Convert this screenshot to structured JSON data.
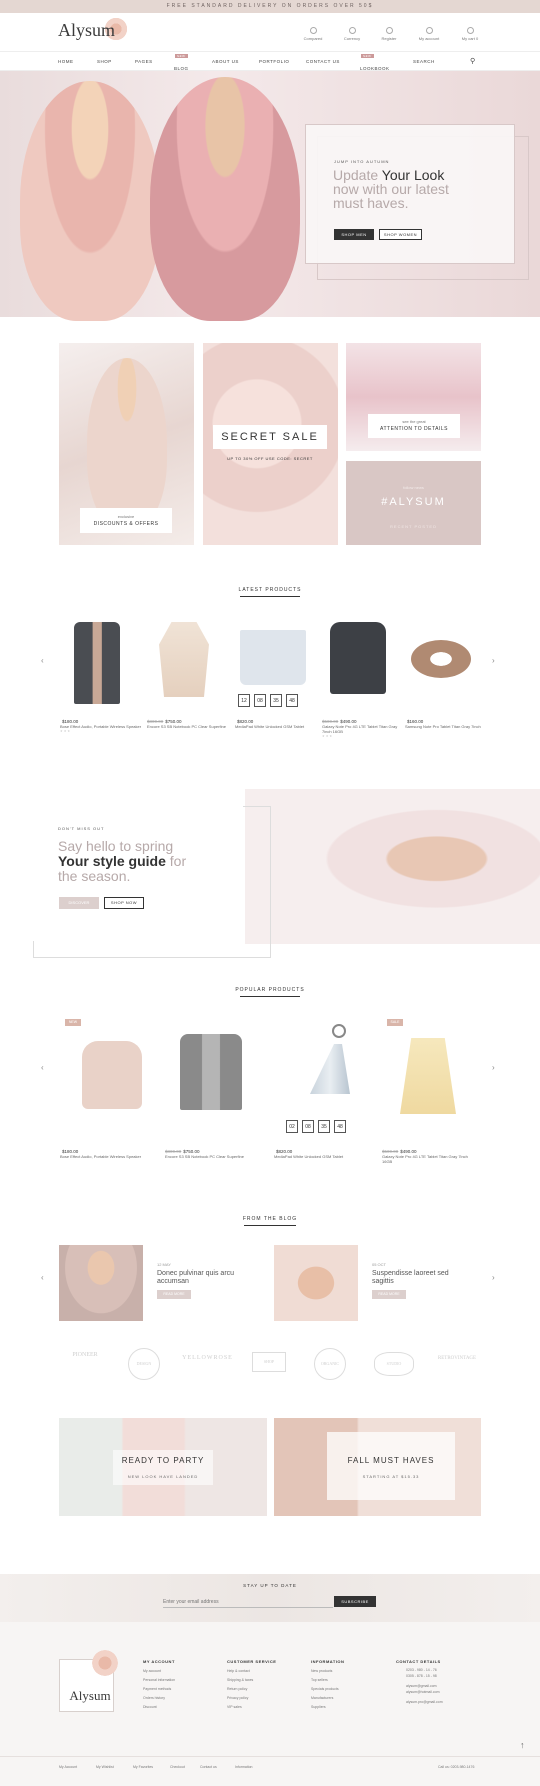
{
  "topbar": {
    "text": "FREE STANDARD DELIVERY ON ORDERS OVER 50$"
  },
  "header": {
    "logo": "Alysum",
    "links": [
      {
        "label": "Compared",
        "icon": "compare-icon"
      },
      {
        "label": "Currency",
        "icon": "currency-icon"
      },
      {
        "label": "Register",
        "icon": "user-icon"
      },
      {
        "label": "My account",
        "icon": "account-icon"
      },
      {
        "label": "My cart 0",
        "icon": "cart-icon"
      }
    ]
  },
  "nav": {
    "items": [
      "HOME",
      "SHOP",
      "PAGES",
      "BLOG",
      "ABOUT US",
      "PORTFOLIO",
      "CONTACT US",
      "LOOKBOOK",
      "SEARCH"
    ],
    "badges": {
      "blog": "NEW",
      "lookbook": "NEW"
    }
  },
  "hero": {
    "kicker": "JUMP INTO AUTUMN",
    "line1": "Update ",
    "line1_bold": "Your Look",
    "line2": "now with our latest",
    "line3": "must haves.",
    "btn_men": "SHOP MEN",
    "btn_women": "SHOP WOMEN"
  },
  "promo": {
    "tile1_small": "exclusive",
    "tile1_big": "DISCOUNTS & OFFERS",
    "sale_title": "SECRET SALE",
    "sale_sub": "UP TO 30% OFF USE CODE: SECRET",
    "tile3_small": "see the great",
    "tile3_big": "ATTENTION TO DETAILS",
    "tile4_small": "follow news",
    "tile4_big": "#ALYSUM",
    "tile4_sub": "RECENT POSTED"
  },
  "latest": {
    "title": "LATEST PRODUCTS",
    "products": [
      {
        "old": "",
        "price": "$180.00",
        "name": "Bose Effect Audio, Portable Wireless Speaker"
      },
      {
        "old": "$800.00",
        "price": "$750.00",
        "name": "Encore S3 SB Notebook PC Clear Superfine"
      },
      {
        "old": "",
        "price": "$820.00",
        "name": "MediaPad White Unlocked GSM Tablet"
      },
      {
        "old": "$500.00",
        "price": "$490.00",
        "name": "Galaxy Note Pro 4G LTE Tablet Titan Gray 7inch 16GB"
      },
      {
        "old": "",
        "price": "$160.00",
        "name": "Samsung Note Pro Tablet Titan Gray 7inch"
      }
    ],
    "countdown": [
      "12",
      "08",
      "35",
      "48"
    ]
  },
  "spring": {
    "kicker": "DON'T MISS OUT",
    "line1": "Say hello to spring",
    "line2_bold": "Your style guide",
    "line2": " for",
    "line3": "the season.",
    "btn1": "DISCOVER",
    "btn2": "SHOP NOW"
  },
  "popular": {
    "title": "POPULAR PRODUCTS",
    "badge_new": "NEW",
    "badge_sale": "SALE",
    "products": [
      {
        "old": "",
        "price": "$180.00",
        "name": "Bose Effect Audio, Portable Wireless Speaker"
      },
      {
        "old": "$800.00",
        "price": "$750.00",
        "name": "Encore S3 SB Notebook PC Clear Superfine"
      },
      {
        "old": "",
        "price": "$820.00",
        "name": "MediaPad White Unlocked GSM Tablet"
      },
      {
        "old": "$500.00",
        "price": "$490.00",
        "name": "Galaxy Note Pro 4G LTE Tablet Titan Gray 7inch 16GB"
      }
    ],
    "countdown": [
      "02",
      "08",
      "35",
      "48"
    ]
  },
  "blog": {
    "title": "FROM THE BLOG",
    "posts": [
      {
        "date": "12 MAY",
        "title": "Donec pulvinar quis arcu accumsan",
        "btn": "READ MORE"
      },
      {
        "date": "05 OCT",
        "title": "Suspendisse laoreet sed sagittis",
        "btn": "READ MORE"
      }
    ]
  },
  "brands": [
    "PIONEER",
    "DESIGN",
    "YELLOWROSE",
    "SHOP",
    "ORGANIC",
    "STUDIO",
    "RETROVINTAGE"
  ],
  "banners": {
    "left_title": "READY TO PARTY",
    "left_sub": "NEW LOOK HAVE LANDED",
    "right_title": "FALL MUST HAVES",
    "right_sub": "STARTING AT $15.33"
  },
  "newsletter": {
    "title": "STAY UP TO DATE",
    "placeholder": "Enter your email address",
    "btn": "SUBSCRIBE"
  },
  "footer": {
    "logo": "Alysum",
    "cols": [
      {
        "title": "MY ACCOUNT",
        "links": [
          "My account",
          "Personal information",
          "Payment methods",
          "Orders history",
          "Discount"
        ]
      },
      {
        "title": "CUSTOMER SERVICE",
        "links": [
          "Help & contact",
          "Shipping & taxes",
          "Return policy",
          "Privacy policy",
          "VIP sales"
        ]
      },
      {
        "title": "INFORMATION",
        "links": [
          "New products",
          "Top sellers",
          "Specials products",
          "Manufacturers",
          "Suppliers"
        ]
      },
      {
        "title": "CONTACT DETAILS",
        "links": [
          "0203 - 980 - 14 - 76",
          "0305 - 878 - 15 - 98",
          "alysum@gmail.com",
          "alysum@hotmail.com",
          "alysum.pro@gmail.com"
        ]
      }
    ],
    "bottom_links": [
      "My Account",
      "My Wishlist",
      "My Favorites",
      "Checkout",
      "Contact us",
      "Information"
    ],
    "phone": "Call us: 0203-980-1476"
  },
  "colors": {
    "accent": "#c9a9a6",
    "topbar": "#e4d7d2",
    "hero": "#eedfe0",
    "dark": "#333333"
  }
}
